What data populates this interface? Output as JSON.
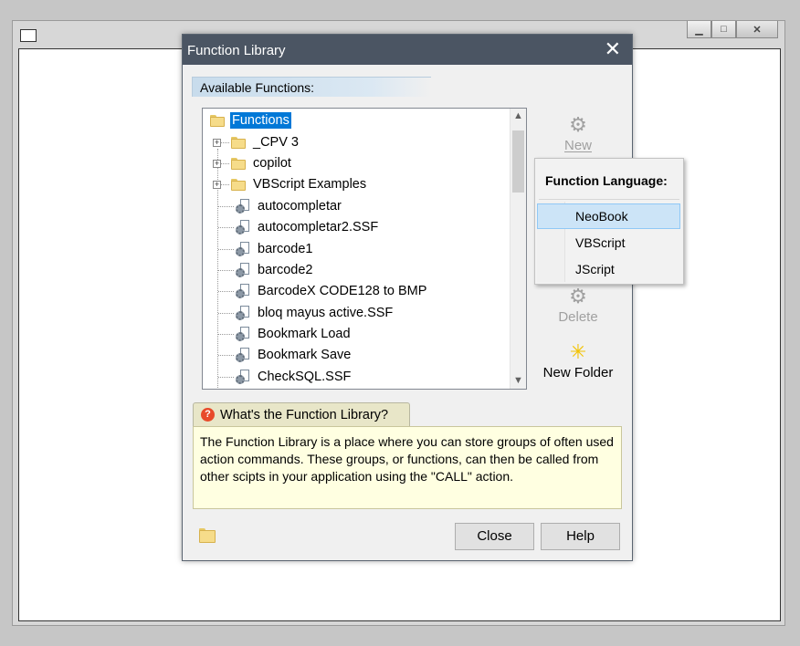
{
  "dialog": {
    "title": "Function Library",
    "close_glyph": "✕",
    "section_header": "Available Functions:",
    "tree": {
      "root_label": "Functions",
      "items": [
        {
          "label": "_CPV 3",
          "type": "folder"
        },
        {
          "label": "copilot",
          "type": "folder"
        },
        {
          "label": "VBScript Examples",
          "type": "folder"
        },
        {
          "label": "autocompletar",
          "type": "function"
        },
        {
          "label": "autocompletar2.SSF",
          "type": "function"
        },
        {
          "label": "barcode1",
          "type": "function"
        },
        {
          "label": "barcode2",
          "type": "function"
        },
        {
          "label": "BarcodeX CODE128 to BMP",
          "type": "function"
        },
        {
          "label": "bloq mayus active.SSF",
          "type": "function"
        },
        {
          "label": "Bookmark Load",
          "type": "function"
        },
        {
          "label": "Bookmark Save",
          "type": "function"
        },
        {
          "label": "CheckSQL.SSF",
          "type": "function"
        }
      ]
    },
    "side_buttons": {
      "new_label": "New",
      "delete_label": "Delete",
      "new_folder_label": "New Folder"
    },
    "help": {
      "tab_label": "What's the Function Library?",
      "text": "The Function Library is a place where you can store groups of often used action commands. These groups, or functions, can then be called from other scipts in your application using the \"CALL\" action."
    },
    "buttons": {
      "close_label": "Close",
      "help_label": "Help"
    }
  },
  "popup_menu": {
    "header": "Function Language:",
    "items": [
      "NeoBook",
      "VBScript",
      "JScript"
    ],
    "highlighted": "NeoBook"
  },
  "colors": {
    "titlebar": "#4b5563",
    "selection": "#0078d7",
    "help_bg": "#ffffe1",
    "menu_highlight": "#cce4f7"
  }
}
